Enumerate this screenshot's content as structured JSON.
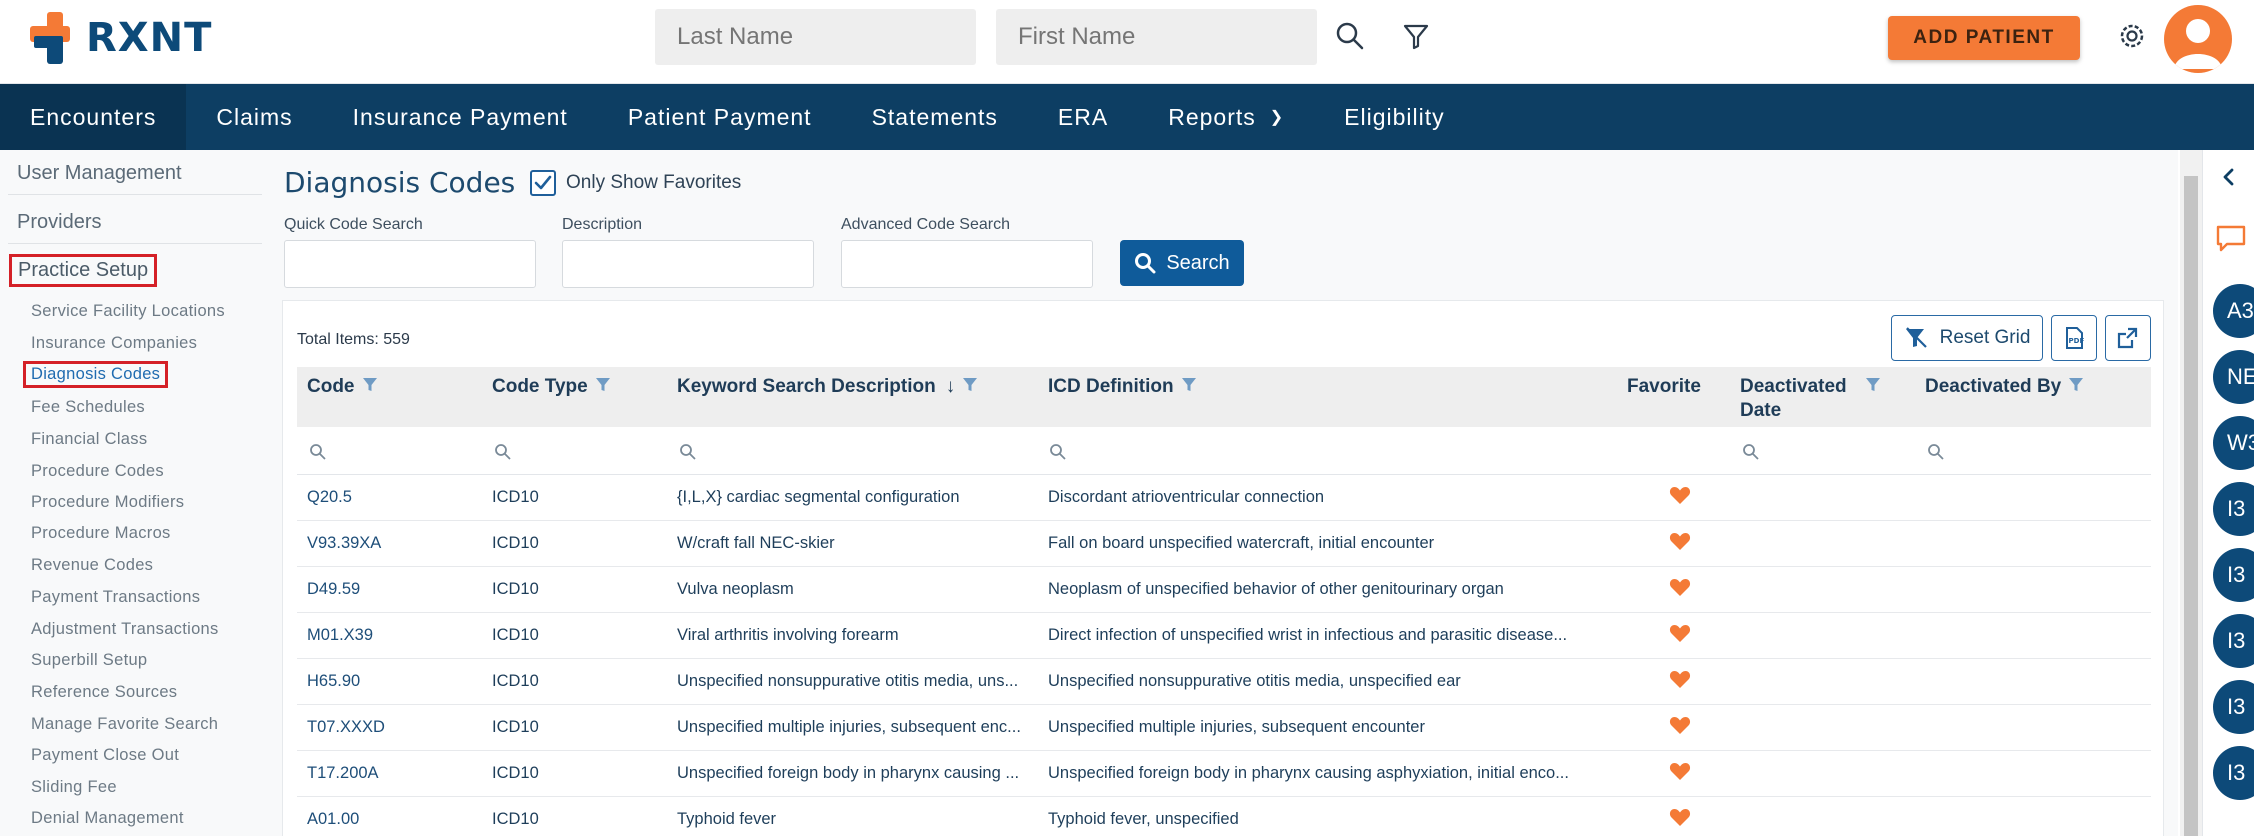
{
  "header": {
    "brand": "RXNT",
    "last_name_placeholder": "Last Name",
    "first_name_placeholder": "First Name",
    "add_patient_label": "ADD PATIENT"
  },
  "nav": {
    "items": [
      "Encounters",
      "Claims",
      "Insurance Payment",
      "Patient Payment",
      "Statements",
      "ERA",
      "Reports",
      "Eligibility"
    ]
  },
  "sidebar": {
    "top_items": [
      "User Management",
      "Providers",
      "Practice Setup"
    ],
    "sub_items": [
      "Service Facility Locations",
      "Insurance Companies",
      "Diagnosis Codes",
      "Fee Schedules",
      "Financial Class",
      "Procedure Codes",
      "Procedure Modifiers",
      "Procedure Macros",
      "Revenue Codes",
      "Payment Transactions",
      "Adjustment Transactions",
      "Superbill Setup",
      "Reference Sources",
      "Manage Favorite Search",
      "Payment Close Out",
      "Sliding Fee",
      "Denial Management"
    ]
  },
  "main": {
    "title": "Diagnosis Codes",
    "only_favorites_label": "Only Show Favorites",
    "quick_code_label": "Quick Code Search",
    "description_label": "Description",
    "advanced_label": "Advanced Code Search",
    "search_label": "Search",
    "total_items": "Total Items: 559",
    "reset_grid_label": "Reset Grid"
  },
  "grid": {
    "columns": [
      "Code",
      "Code Type",
      "Keyword Search Description",
      "ICD Definition",
      "Favorite",
      "Deactivated Date",
      "Deactivated By"
    ],
    "rows": [
      {
        "code": "Q20.5",
        "type": "ICD10",
        "keyword": "{I,L,X} cardiac segmental configuration",
        "definition": "Discordant atrioventricular connection"
      },
      {
        "code": "V93.39XA",
        "type": "ICD10",
        "keyword": "W/craft fall NEC-skier",
        "definition": "Fall on board unspecified watercraft, initial encounter"
      },
      {
        "code": "D49.59",
        "type": "ICD10",
        "keyword": "Vulva neoplasm",
        "definition": "Neoplasm of unspecified behavior of other genitourinary organ"
      },
      {
        "code": "M01.X39",
        "type": "ICD10",
        "keyword": "Viral arthritis involving forearm",
        "definition": "Direct infection of unspecified wrist in infectious and parasitic disease..."
      },
      {
        "code": "H65.90",
        "type": "ICD10",
        "keyword": "Unspecified nonsuppurative otitis media, uns...",
        "definition": "Unspecified nonsuppurative otitis media, unspecified ear"
      },
      {
        "code": "T07.XXXD",
        "type": "ICD10",
        "keyword": "Unspecified multiple injuries, subsequent enc...",
        "definition": "Unspecified multiple injuries, subsequent encounter"
      },
      {
        "code": "T17.200A",
        "type": "ICD10",
        "keyword": "Unspecified foreign body in pharynx causing ...",
        "definition": "Unspecified foreign body in pharynx causing asphyxiation, initial enco..."
      },
      {
        "code": "A01.00",
        "type": "ICD10",
        "keyword": "Typhoid fever",
        "definition": "Typhoid fever, unspecified"
      }
    ]
  },
  "rail": {
    "badges": [
      "A3",
      "NE",
      "W3",
      "I3",
      "I3",
      "I3",
      "I3",
      "I3"
    ]
  },
  "colors": {
    "brand_navy": "#0d3e63",
    "accent_orange": "#f47a36",
    "highlight_red": "#d42027"
  }
}
